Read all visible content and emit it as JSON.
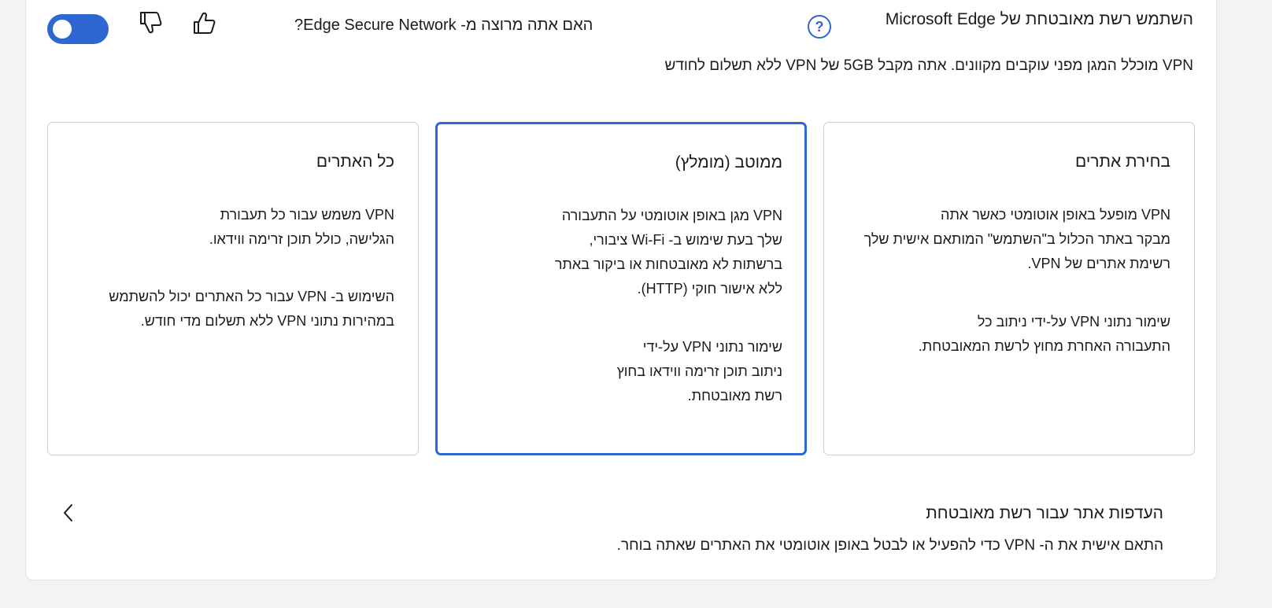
{
  "header": {
    "title": "השתמש רשת מאובטחת של Microsoft Edge",
    "help_icon": "question-circle-icon",
    "feedback_question": "האם אתה מרוצה מ- Edge Secure Network?",
    "thumbs_up_icon": "thumbs-up-icon",
    "thumbs_down_icon": "thumbs-down-icon",
    "toggle_state": "on",
    "subtitle": "VPN מוכלל המגן מפני עוקבים מקוונים. אתה מקבל 5GB של VPN ללא תשלום לחודש"
  },
  "options": [
    {
      "title": "בחירת אתרים",
      "selected": false,
      "para1": [
        "VPN מופעל באופן אוטומטי כאשר אתה",
        "מבקר באתר הכלול ב\"השתמש\" המותאם אישית שלך",
        "רשימת אתרים של VPN."
      ],
      "para2": [
        "שימור נתוני VPN על-ידי ניתוב כל",
        "התעבורה האחרת מחוץ לרשת המאובטחת."
      ]
    },
    {
      "title": "ממוטב (מומלץ)",
      "selected": true,
      "para1": [
        "VPN מגן באופן אוטומטי על התעבורה",
        "שלך בעת שימוש ב- Wi-Fi ציבורי,",
        "ברשתות לא מאובטחות או ביקור באתר",
        "ללא אישור חוקי (HTTP)."
      ],
      "para2": [
        "שימור נתוני VPN על-ידי",
        "ניתוב תוכן זרימה ווידאו בחוץ",
        "רשת מאובטחת."
      ]
    },
    {
      "title": "כל האתרים",
      "selected": false,
      "para1": [
        "VPN משמש עבור כל תעבורת",
        "הגלישה, כולל תוכן זרימה ווידאו."
      ],
      "para2": [
        "השימוש ב- VPN עבור כל האתרים יכול להשתמש",
        "במהירות נתוני VPN ללא תשלום מדי חודש."
      ]
    }
  ],
  "preferences": {
    "title": "העדפות אתר עבור רשת מאובטחת",
    "description": "התאם אישית את ה- VPN כדי להפעיל או לבטל באופן אוטומטי את האתרים שאתה בוחר.",
    "chevron_icon": "chevron-left-icon"
  },
  "colors": {
    "accent": "#2e67d1",
    "card_border": "#cfcfcf",
    "background": "#f3f3f3"
  }
}
